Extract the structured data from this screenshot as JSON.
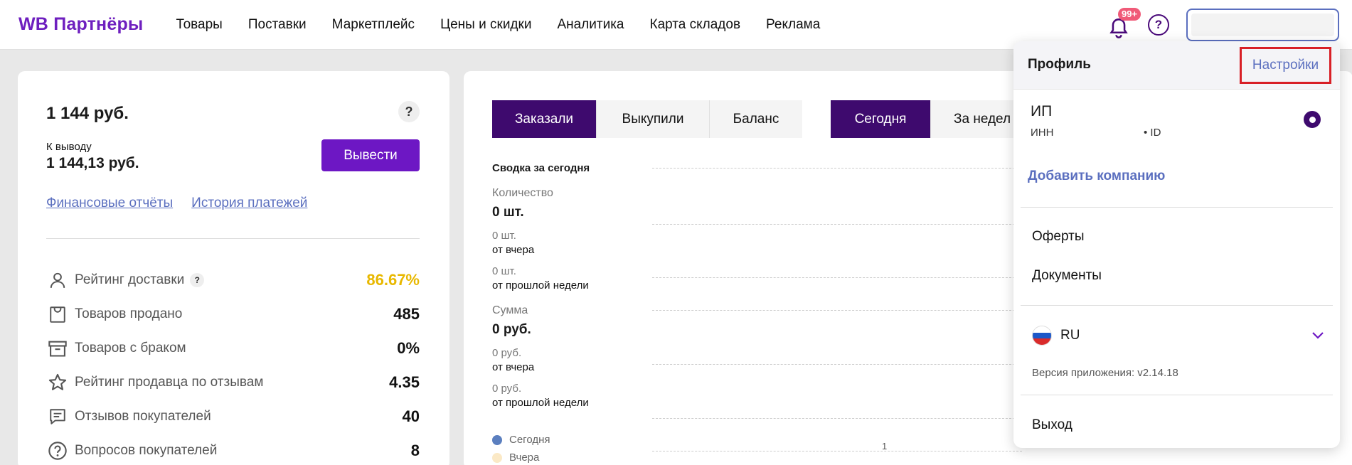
{
  "header": {
    "logo": "WB Партнёры",
    "nav": [
      "Товары",
      "Поставки",
      "Маркетплейс",
      "Цены и скидки",
      "Аналитика",
      "Карта складов",
      "Реклама"
    ],
    "notifications_badge": "99+"
  },
  "balance": {
    "amount": "1 144 руб.",
    "help": "?",
    "withdraw_label": "К выводу",
    "withdraw_amount": "1 144,13 руб.",
    "withdraw_button": "Вывести",
    "links": [
      "Финансовые отчёты",
      "История платежей"
    ]
  },
  "stats": [
    {
      "label": "Рейтинг доставки",
      "value": "86.67%",
      "icon": "person-icon",
      "help": "?"
    },
    {
      "label": "Товаров продано",
      "value": "485",
      "icon": "bag-icon"
    },
    {
      "label": "Товаров с браком",
      "value": "0%",
      "icon": "box-icon"
    },
    {
      "label": "Рейтинг продавца по отзывам",
      "value": "4.35",
      "icon": "star-icon"
    },
    {
      "label": "Отзывов покупателей",
      "value": "40",
      "icon": "message-icon"
    },
    {
      "label": "Вопросов покупателей",
      "value": "8",
      "icon": "question-icon"
    }
  ],
  "tabs_metric": [
    "Заказали",
    "Выкупили",
    "Баланс"
  ],
  "tabs_period": [
    "Сегодня",
    "За недел"
  ],
  "summary": {
    "title": "Сводка за сегодня",
    "qty_label": "Количество",
    "qty_value": "0 шт.",
    "qty_yesterday_value": "0 шт.",
    "qty_yesterday_label": "от вчера",
    "qty_week_value": "0 шт.",
    "qty_week_label": "от прошлой недели",
    "sum_label": "Сумма",
    "sum_value": "0 руб.",
    "sum_yesterday_value": "0 руб.",
    "sum_yesterday_label": "от вчера",
    "sum_week_value": "0 руб.",
    "sum_week_label": "от прошлой недели"
  },
  "legend": [
    {
      "label": "Сегодня",
      "color": "#5b7fbf"
    },
    {
      "label": "Вчера",
      "color": "#fbe9c6"
    }
  ],
  "axis_tick": "1",
  "profile": {
    "title": "Профиль",
    "settings": "Настройки",
    "company": "ИП",
    "inn": "ИНН",
    "id": "• ID",
    "add_company": "Добавить компанию",
    "offers": "Оферты",
    "documents": "Документы",
    "language": "RU",
    "version": "Версия приложения: v2.14.18",
    "logout": "Выход"
  },
  "colors": {
    "accent": "#6d17c4",
    "dark_accent": "#3e0a6e",
    "link": "#5b6fbf",
    "highlight": "#d81f26",
    "rating": "#e8b800"
  }
}
